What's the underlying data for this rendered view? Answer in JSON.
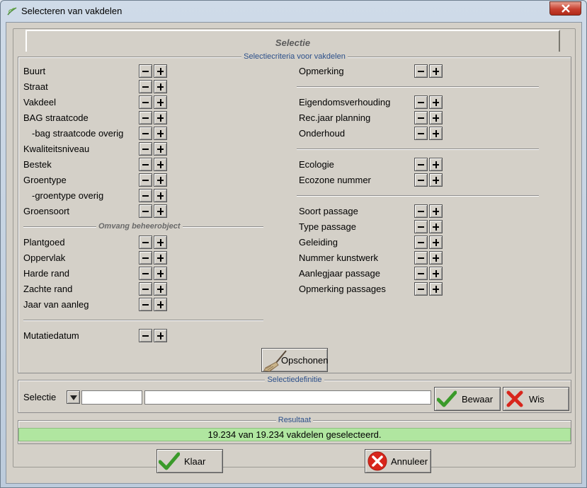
{
  "window": {
    "title": "Selecteren van vakdelen"
  },
  "tab": {
    "label": "Selectie"
  },
  "criteria": {
    "legend": "Selectiecriteria voor vakdelen",
    "omvang_header": "Omvang beheerobject",
    "left_group1": [
      {
        "label": "Buurt",
        "indent": false
      },
      {
        "label": "Straat",
        "indent": false
      },
      {
        "label": "Vakdeel",
        "indent": false
      },
      {
        "label": "BAG straatcode",
        "indent": false
      },
      {
        "label": "-bag straatcode overig",
        "indent": true
      },
      {
        "label": "Kwaliteitsniveau",
        "indent": false
      },
      {
        "label": "Bestek",
        "indent": false
      },
      {
        "label": "Groentype",
        "indent": false
      },
      {
        "label": "-groentype overig",
        "indent": true
      },
      {
        "label": "Groensoort",
        "indent": false
      }
    ],
    "left_group2": [
      {
        "label": "Plantgoed"
      },
      {
        "label": "Oppervlak"
      },
      {
        "label": "Harde rand"
      },
      {
        "label": "Zachte rand"
      },
      {
        "label": "Jaar van aanleg"
      }
    ],
    "left_group3": [
      {
        "label": "Mutatiedatum"
      }
    ],
    "right_group1": [
      {
        "label": "Opmerking"
      }
    ],
    "right_group2": [
      {
        "label": "Eigendomsverhouding"
      },
      {
        "label": "Rec.jaar planning"
      },
      {
        "label": "Onderhoud"
      }
    ],
    "right_group3": [
      {
        "label": "Ecologie"
      },
      {
        "label": "Ecozone nummer"
      }
    ],
    "right_group4": [
      {
        "label": "Soort passage"
      },
      {
        "label": "Type passage"
      },
      {
        "label": "Geleiding"
      },
      {
        "label": "Nummer kunstwerk"
      },
      {
        "label": "Aanlegjaar passage"
      },
      {
        "label": "Opmerking passages"
      }
    ],
    "clear_button": "Opschonen"
  },
  "definitie": {
    "legend": "Selectiedefinitie",
    "label": "Selectie",
    "code_value": "",
    "name_value": "",
    "save_button": "Bewaar",
    "delete_button": "Wis"
  },
  "resultaat": {
    "legend": "Resultaat",
    "text": "19.234 van 19.234 vakdelen geselecteerd."
  },
  "footer": {
    "ok_button": "Klaar",
    "cancel_button": "Annuleer"
  },
  "colors": {
    "result_bg": "#b0e6a0",
    "legend_text": "#2b4f8a",
    "check_green": "#3a9a2a",
    "cross_red": "#d8261c"
  }
}
